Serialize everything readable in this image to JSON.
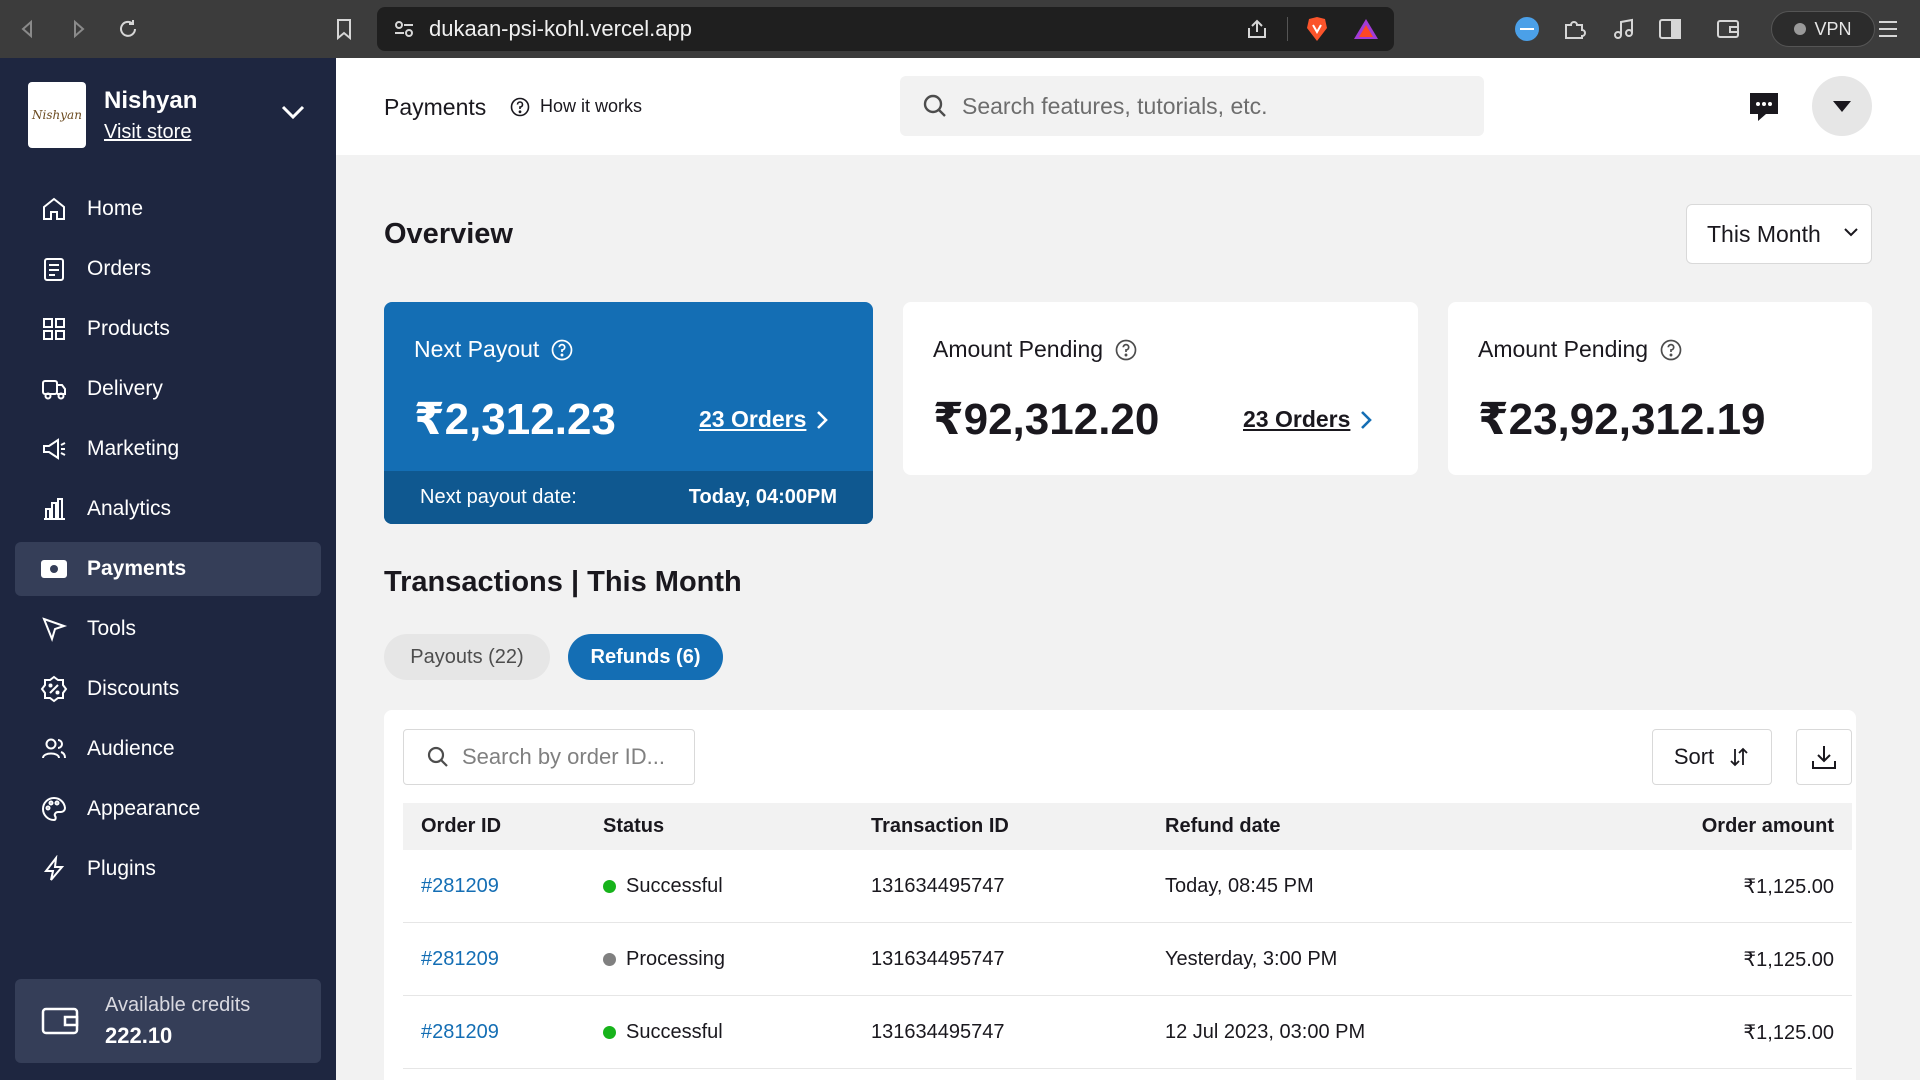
{
  "browser": {
    "url": "dukaan-psi-kohl.vercel.app",
    "vpn_label": "VPN"
  },
  "store": {
    "name": "Nishyan",
    "visit_label": "Visit store",
    "logo_text": "Nishyan"
  },
  "sidebar": {
    "items": [
      {
        "label": "Home",
        "icon": "home-icon"
      },
      {
        "label": "Orders",
        "icon": "orders-icon"
      },
      {
        "label": "Products",
        "icon": "products-icon"
      },
      {
        "label": "Delivery",
        "icon": "delivery-truck-icon"
      },
      {
        "label": "Marketing",
        "icon": "megaphone-icon"
      },
      {
        "label": "Analytics",
        "icon": "bar-chart-icon"
      },
      {
        "label": "Payments",
        "icon": "payments-icon",
        "active": true
      },
      {
        "label": "Tools",
        "icon": "cursor-icon"
      },
      {
        "label": "Discounts",
        "icon": "discount-badge-icon"
      },
      {
        "label": "Audience",
        "icon": "people-icon"
      },
      {
        "label": "Appearance",
        "icon": "palette-icon"
      },
      {
        "label": "Plugins",
        "icon": "lightning-icon"
      }
    ],
    "credits": {
      "label": "Available credits",
      "value": "222.10"
    }
  },
  "header": {
    "title": "Payments",
    "how_it_works": "How it works",
    "search_placeholder": "Search features, tutorials, etc."
  },
  "overview": {
    "title": "Overview",
    "period": "This Month",
    "cards": [
      {
        "title": "Next Payout",
        "amount": "₹2,312.23",
        "orders_link": "23 Orders",
        "footer_label": "Next payout date:",
        "footer_value": "Today, 04:00PM"
      },
      {
        "title": "Amount Pending",
        "amount": "₹92,312.20",
        "orders_link": "23 Orders"
      },
      {
        "title": "Amount Pending",
        "amount": "₹23,92,312.19"
      }
    ]
  },
  "transactions": {
    "title": "Transactions | This Month",
    "tabs": [
      {
        "label": "Payouts (22)",
        "active": false
      },
      {
        "label": "Refunds (6)",
        "active": true
      }
    ],
    "search_placeholder": "Search by order ID...",
    "sort_label": "Sort",
    "columns": [
      "Order ID",
      "Status",
      "Transaction ID",
      "Refund date",
      "Order amount"
    ],
    "rows": [
      {
        "order_id": "#281209",
        "status": "Successful",
        "status_color": "#17b31b",
        "transaction_id": "131634495747",
        "date": "Today, 08:45 PM",
        "amount": "₹1,125.00"
      },
      {
        "order_id": "#281209",
        "status": "Processing",
        "status_color": "#808080",
        "transaction_id": "131634495747",
        "date": "Yesterday, 3:00 PM",
        "amount": "₹1,125.00"
      },
      {
        "order_id": "#281209",
        "status": "Successful",
        "status_color": "#17b31b",
        "transaction_id": "131634495747",
        "date": "12 Jul 2023, 03:00 PM",
        "amount": "₹1,125.00"
      }
    ]
  },
  "colors": {
    "sidebar_bg": "#1e2640",
    "accent_blue": "#146eb4",
    "page_bg": "#f2f2f2"
  }
}
